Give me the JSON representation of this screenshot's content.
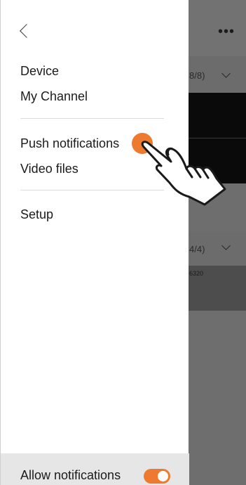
{
  "drawer": {
    "items": [
      {
        "label": "Device"
      },
      {
        "label": "My Channel"
      },
      {
        "label": "Push notifications"
      },
      {
        "label": "Video files"
      },
      {
        "label": "Setup"
      }
    ],
    "footer": {
      "label": "Allow notifications",
      "toggle_on": true
    }
  },
  "background": {
    "more_icon": "more-horizontal-icon",
    "section1_count": "8/8)",
    "section2_count": "4/4)",
    "item_text": "6320"
  },
  "colors": {
    "accent": "#ee7a30",
    "drawer_bg": "#ffffff",
    "footer_bg": "#e6e6e6",
    "overlay": "#6e6e6e"
  }
}
